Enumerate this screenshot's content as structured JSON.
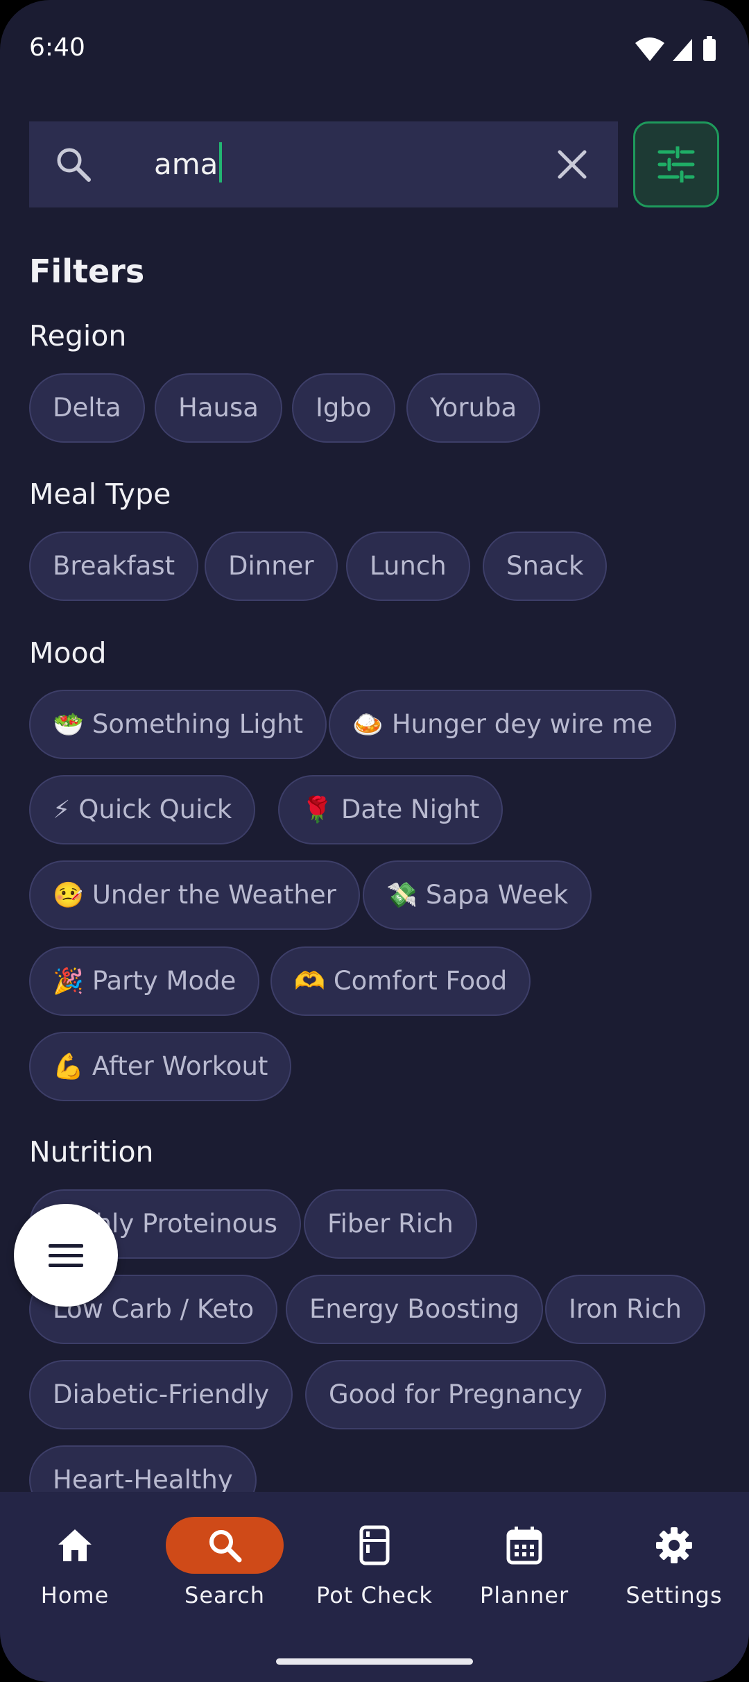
{
  "status_bar": {
    "time": "6:40"
  },
  "search": {
    "query": "ama"
  },
  "filters": {
    "title": "Filters",
    "sections": [
      {
        "label": "Region",
        "chips": [
          "Delta",
          "Hausa",
          "Igbo",
          "Yoruba"
        ]
      },
      {
        "label": "Meal Type",
        "chips": [
          "Breakfast",
          "Dinner",
          "Lunch",
          "Snack"
        ]
      },
      {
        "label": "Mood",
        "chips": [
          {
            "emoji": "🥗",
            "text": "Something Light"
          },
          {
            "emoji": "🍛",
            "text": "Hunger dey wire me"
          },
          {
            "emoji": "⚡",
            "text": "Quick Quick"
          },
          {
            "emoji": "🌹",
            "text": "Date Night"
          },
          {
            "emoji": "🤒",
            "text": "Under the Weather"
          },
          {
            "emoji": "💸",
            "text": "Sapa Week"
          },
          {
            "emoji": "🎉",
            "text": "Party Mode"
          },
          {
            "emoji": "🫶",
            "text": "Comfort Food"
          },
          {
            "emoji": "💪",
            "text": "After Workout"
          }
        ]
      },
      {
        "label": "Nutrition",
        "chips": [
          "Highly Proteinous",
          "Fiber Rich",
          "Low Carb / Keto",
          "Energy Boosting",
          "Iron Rich",
          "Diabetic-Friendly",
          "Good for Pregnancy",
          "Heart-Healthy"
        ]
      }
    ]
  },
  "nav": {
    "items": [
      {
        "label": "Home",
        "icon": "home-icon"
      },
      {
        "label": "Search",
        "icon": "search-icon",
        "active": true
      },
      {
        "label": "Pot Check",
        "icon": "fridge-icon"
      },
      {
        "label": "Planner",
        "icon": "calendar-icon"
      },
      {
        "label": "Settings",
        "icon": "gear-icon"
      }
    ]
  },
  "colors": {
    "background": "#1b1c32",
    "accent_green": "#22b572",
    "accent_orange": "#cf4a18",
    "chip_bg": "#2b2c4e"
  }
}
